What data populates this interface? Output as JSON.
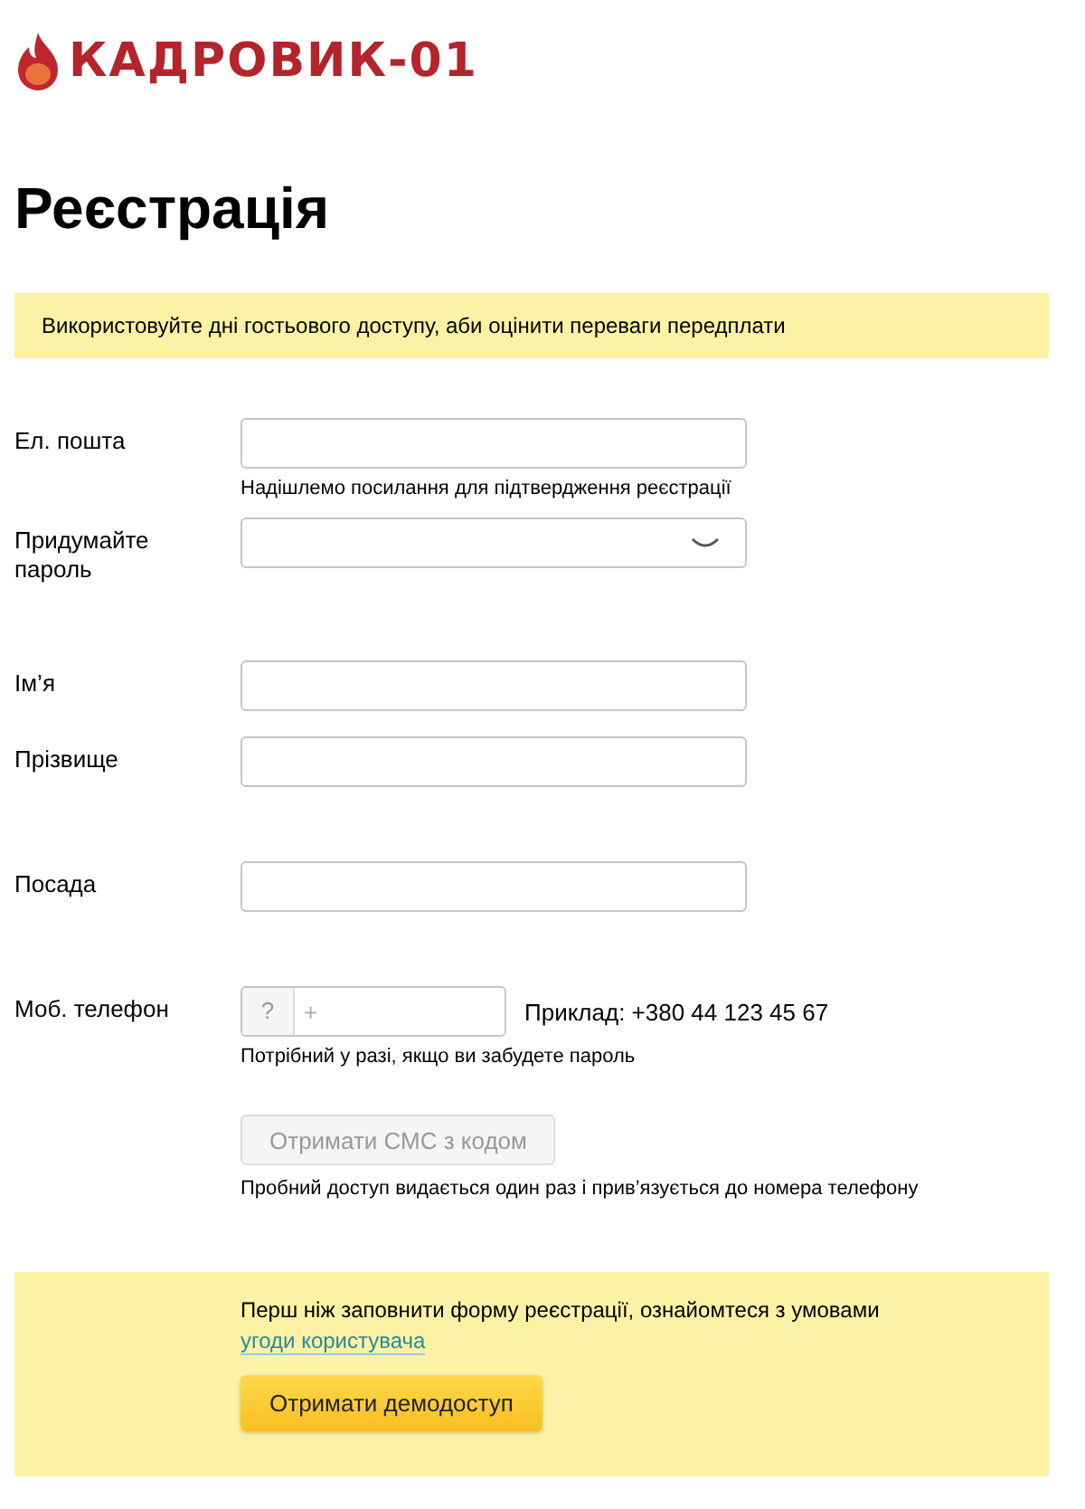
{
  "logo": {
    "text": "КАДРОВИК-01"
  },
  "title": "Реєстрація",
  "notice": "Використовуйте дні гостьового доступу, аби оцінити переваги передплати",
  "fields": [
    {
      "kind": "text",
      "label": "Ел. пошта",
      "hint": "Надішлемо посилання для підтвердження реєстрації"
    },
    {
      "kind": "password",
      "label": "Придумайте пароль"
    },
    {
      "kind": "text",
      "label": "Ім’я"
    },
    {
      "kind": "text",
      "label": "Прізвище"
    },
    {
      "kind": "text",
      "label": "Посада"
    },
    {
      "kind": "phone",
      "label": "Моб. телефон",
      "prefix": "?",
      "placeholder": "+",
      "example": "Приклад: +380 44 123 45 67",
      "hint": "Потрібний у разі, якщо ви забудете пароль"
    }
  ],
  "sms_button": {
    "label": "Отримати СМС з кодом",
    "disabled": true
  },
  "sms_note": "Пробний доступ видається один раз і прив’язується до номера телефону",
  "agreement": {
    "text": "Перш ніж заповнити форму реєстрації, ознайомтеся з умовами",
    "link": "угоди користувача"
  },
  "submit_button": "Отримати демодоступ"
}
